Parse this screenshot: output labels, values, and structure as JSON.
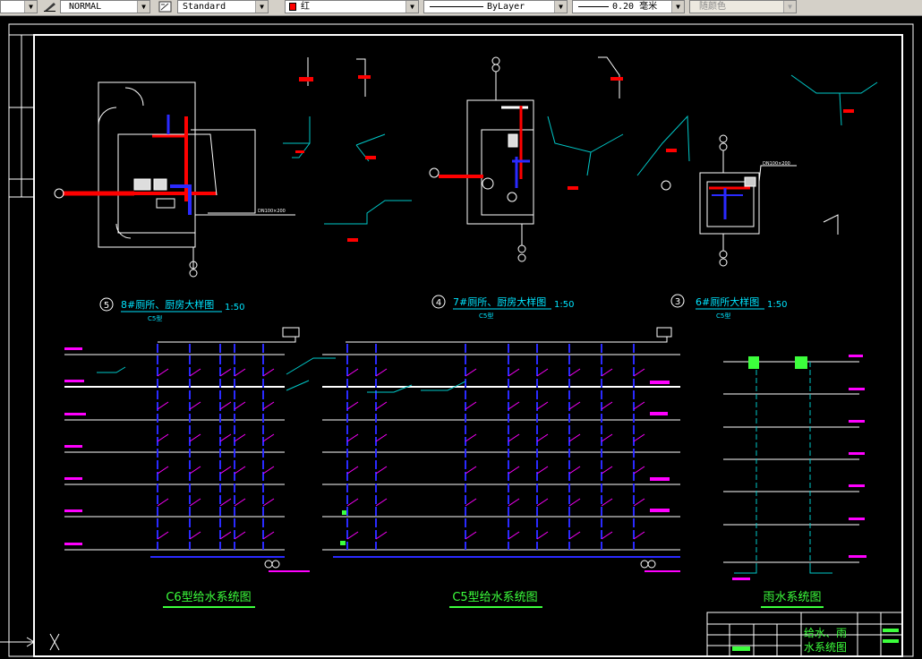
{
  "toolbar": {
    "plot_style": "NORMAL",
    "text_style": "Standard",
    "color": "红",
    "linetype": "ByLayer",
    "lineweight": "0.20 毫米",
    "plot_color": "随颜色"
  },
  "details": [
    {
      "num": "5",
      "title": "8#厕所、厨房大样图",
      "scale": "1:50",
      "sub": "C5型"
    },
    {
      "num": "4",
      "title": "7#厕所、厨房大样图",
      "scale": "1:50",
      "sub": "C5型"
    },
    {
      "num": "3",
      "title": "6#厕所大样图",
      "scale": "1:50",
      "sub": "C5型"
    }
  ],
  "systems": {
    "c6": "C6型给水系统图",
    "c5": "C5型给水系统图",
    "rain": "雨水系统图"
  },
  "title_block": {
    "drawing_name_1": "给水、雨",
    "drawing_name_2": "水系统图"
  },
  "colors": {
    "water_pipe": "#2a2aff",
    "rain_pipe": "#00c8c8",
    "annotation": "#ff00ff",
    "grid": "#ffffff",
    "text_cyan": "#00e5ff",
    "title_green": "#3cff3c",
    "hot_pipe": "#ff0000"
  }
}
